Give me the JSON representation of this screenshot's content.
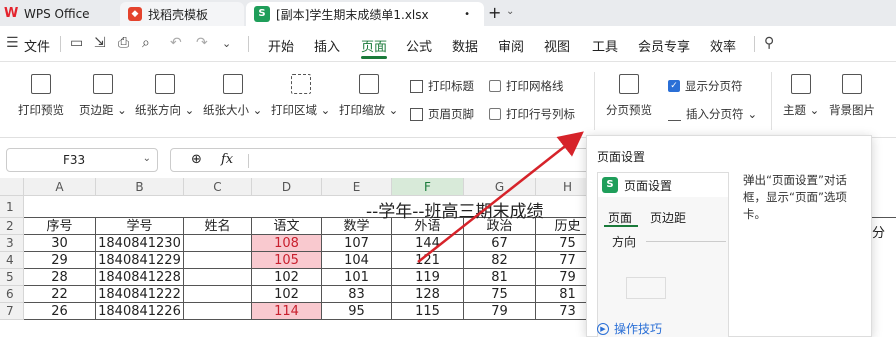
{
  "tabs": {
    "wps_label": "WPS Office",
    "template_label": "找稻壳模板",
    "file_label": "[副本]学生期末成绩单1.xlsx",
    "file_dot": "•",
    "new_tab": "+"
  },
  "menubar": {
    "file_menu": "文件",
    "items": [
      "开始",
      "插入",
      "页面",
      "公式",
      "数据",
      "审阅",
      "视图",
      "工具",
      "会员专享",
      "效率"
    ],
    "active": "页面"
  },
  "ribbon": {
    "print_preview": "打印预览",
    "margins": "页边距",
    "orientation": "纸张方向",
    "paper_size": "纸张大小",
    "print_area": "打印区域",
    "print_scale": "打印缩放",
    "print_titles": "打印标题",
    "header_footer": "页眉页脚",
    "print_gridlines": "打印网格线",
    "print_row_col_labels": "打印行号列标",
    "page_break_preview": "分页预览",
    "show_page_breaks": "显示分页符",
    "insert_page_break": "插入分页符",
    "theme": "主题",
    "background_image": "背景图片",
    "dropdown_marker": "⌄"
  },
  "formula_bar": {
    "cell_ref": "F33",
    "fx": "fx"
  },
  "grid": {
    "columns": [
      "A",
      "B",
      "C",
      "D",
      "E",
      "F",
      "G",
      "H"
    ],
    "rows": [
      "1",
      "2",
      "3",
      "4",
      "5",
      "6",
      "7"
    ],
    "title": "--学年--班高三期末成绩",
    "headers": [
      "序号",
      "学号",
      "姓名",
      "语文",
      "数学",
      "外语",
      "政治",
      "历史"
    ],
    "data": [
      [
        "30",
        "1840841230",
        "",
        "108",
        "107",
        "144",
        "67",
        "75"
      ],
      [
        "29",
        "1840841229",
        "",
        "105",
        "104",
        "121",
        "82",
        "77"
      ],
      [
        "28",
        "1840841228",
        "",
        "102",
        "101",
        "119",
        "81",
        "79"
      ],
      [
        "22",
        "1840841222",
        "",
        "102",
        "83",
        "128",
        "75",
        "81"
      ],
      [
        "26",
        "1840841226",
        "",
        "114",
        "95",
        "115",
        "79",
        "73"
      ]
    ],
    "highlight_rows": [
      0,
      1,
      4
    ],
    "right_edge_char": "分"
  },
  "popup": {
    "title": "页面设置",
    "preview_head": "页面设置",
    "preview_tab1": "页面",
    "preview_tab2": "页边距",
    "preview_direction": "方向",
    "description": "弹出“页面设置”对话框，显示“页面”选项卡。",
    "tips": "操作技巧"
  },
  "colors": {
    "accent_green": "#1a7a3a",
    "highlight_pink": "#f9c9cf",
    "arrow_red": "#d6232a",
    "link_blue": "#2a6fd6"
  }
}
